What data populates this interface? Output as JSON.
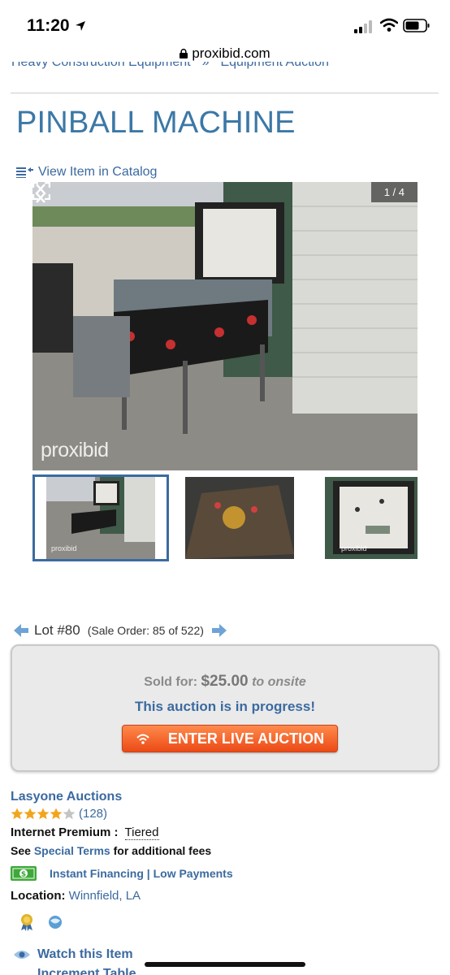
{
  "status_bar": {
    "time": "11:20",
    "url": "proxibid.com"
  },
  "breadcrumb": [
    "Heavy Construction Equipment",
    "Equipment Auction"
  ],
  "title": "PINBALL MACHINE",
  "catalog_link": "View Item in Catalog",
  "gallery": {
    "counter": "1 / 4",
    "watermark": "proxibid",
    "thumb_watermark": "proxibid"
  },
  "lot": {
    "label": "Lot #80",
    "sale_order": "(Sale Order: 85 of 522)"
  },
  "auction": {
    "sold_prefix": "Sold for:",
    "sold_price": "$25.00",
    "sold_to": "to onsite",
    "status": "This auction is in progress!",
    "live_button": "ENTER LIVE AUCTION"
  },
  "seller": {
    "name": "Lasyone Auctions",
    "stars": 4,
    "rating_count": "(128)",
    "premium_label": "Internet Premium :",
    "premium_value": "Tiered",
    "terms_prefix": "See",
    "terms_link": "Special Terms",
    "terms_suffix": "for additional fees",
    "financing": "Instant Financing | Low Payments",
    "location_label": "Location:",
    "location_value": "Winnfield, LA"
  },
  "actions": {
    "watch": "Watch this Item",
    "increment": "Increment Table"
  },
  "colors": {
    "link": "#3b6aa0",
    "title": "#3b78a6",
    "live_button": "#ec4a16"
  }
}
